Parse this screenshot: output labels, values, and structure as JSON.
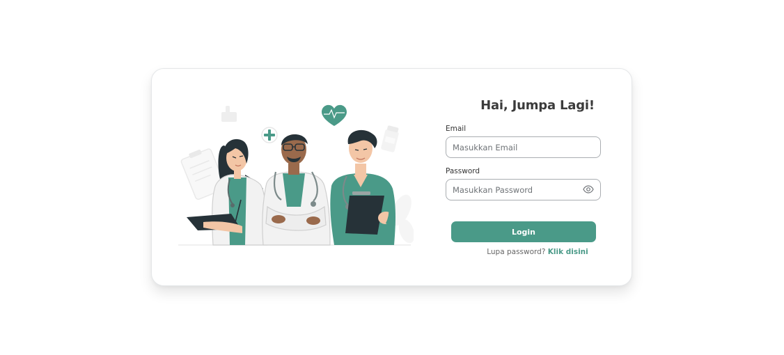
{
  "login": {
    "title": "Hai, Jumpa Lagi!",
    "email_label": "Email",
    "email_placeholder": "Masukkan Email",
    "password_label": "Password",
    "password_placeholder": "Masukkan Password",
    "login_button": "Login",
    "forgot_text": "Lupa password?",
    "forgot_link": "Klik disini"
  },
  "illustration": {
    "subject": "medical-team",
    "icons": [
      "thumbs-up-icon",
      "plus-icon",
      "heart-icon",
      "clipboard-icon",
      "medicine-bottle-icon"
    ]
  },
  "colors": {
    "accent": "#4a9a88",
    "title_text": "#3b3b3b",
    "input_border": "#a9adb1",
    "card_border": "#e4e6e8"
  }
}
